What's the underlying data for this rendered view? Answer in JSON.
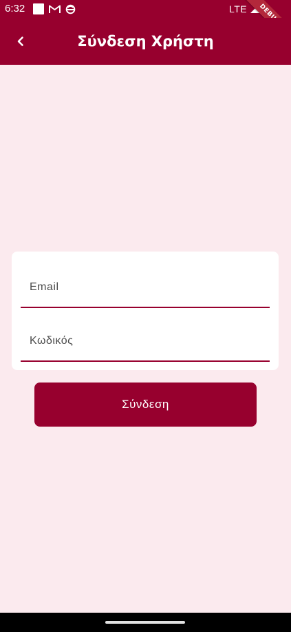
{
  "status_bar": {
    "time": "6:32",
    "network": "LTE",
    "icons": [
      "square-icon",
      "gmail-icon",
      "sync-icon",
      "signal-icon"
    ]
  },
  "debug_banner": {
    "label": "DEBUG"
  },
  "app_bar": {
    "title": "Σύνδεση Χρήστη",
    "back_icon": "chevron-left-icon"
  },
  "form": {
    "email": {
      "placeholder": "Email",
      "value": ""
    },
    "password": {
      "placeholder": "Κωδικός",
      "value": ""
    },
    "submit_label": "Σύνδεση"
  },
  "colors": {
    "primary": "#97002e",
    "background": "#fbeaee",
    "card": "#ffffff"
  }
}
